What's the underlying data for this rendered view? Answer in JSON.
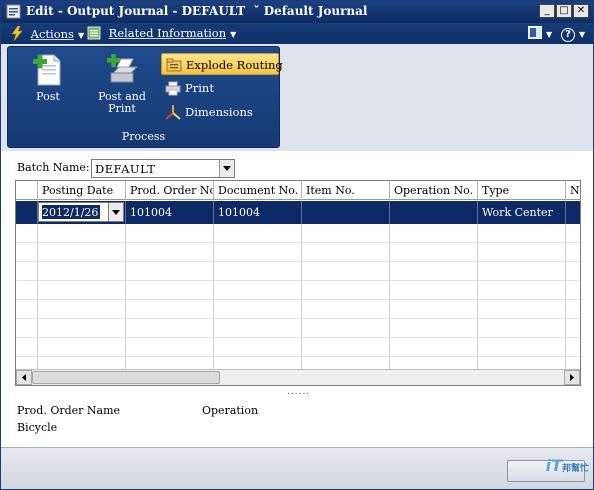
{
  "window": {
    "title": "Edit - Output Journal - DEFAULT  ˇ Default Journal",
    "controls": [
      "minimize",
      "restore",
      "close"
    ]
  },
  "menubar": {
    "actions_label": "Actions",
    "related_label": "Related Information",
    "help_symbol": "?"
  },
  "ribbon": {
    "group_label": "Process",
    "post_label": "Post",
    "post_and_print_line1": "Post and",
    "post_and_print_line2": "Print",
    "explode_routing_label": "Explode Routing",
    "print_label": "Print",
    "dimensions_label": "Dimensions"
  },
  "batch": {
    "label": "Batch Name:",
    "value": "DEFAULT"
  },
  "grid": {
    "columns": [
      "Posting Date",
      "Prod. Order No.",
      "Document No.",
      "Item No.",
      "Operation No.",
      "Type",
      "No"
    ],
    "selected_row": {
      "posting_date": "2012/1/26",
      "prod_order_no": "101004",
      "document_no": "101004",
      "item_no": "",
      "operation_no": "",
      "type": "Work Center",
      "no": ""
    }
  },
  "splitter": "......",
  "factbox": {
    "prod_order_name_label": "Prod. Order Name",
    "operation_label": "Operation",
    "prod_order_name_value": "Bicycle"
  },
  "watermark": {
    "brand": "iT",
    "sub": "邦幫忙"
  }
}
